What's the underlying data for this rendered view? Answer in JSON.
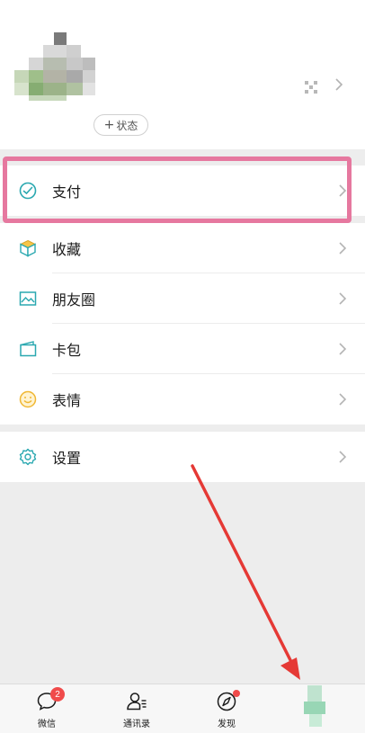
{
  "profile": {
    "status_label": "状态",
    "status_plus": "+"
  },
  "menu": {
    "pay": "支付",
    "favorites": "收藏",
    "moments": "朋友圈",
    "cards": "卡包",
    "stickers": "表情",
    "settings": "设置"
  },
  "tabbar": {
    "chats": "微信",
    "chats_badge": "2",
    "contacts": "通讯录",
    "discover": "发现"
  },
  "colors": {
    "highlight": "#e6789f",
    "arrow": "#e53935",
    "badge": "#f04b4b",
    "icon_teal": "#2aa8b0"
  }
}
